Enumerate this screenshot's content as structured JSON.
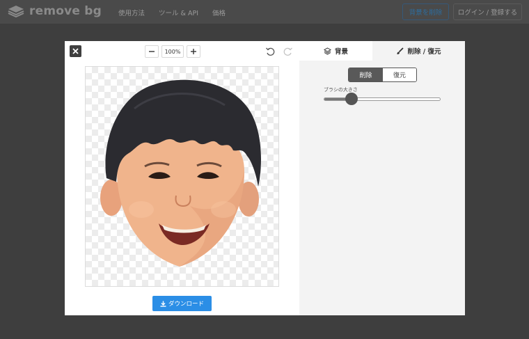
{
  "header": {
    "logo_text": "remove bg",
    "nav": [
      "使用方法",
      "ツール & API",
      "価格"
    ],
    "remove_bg_label": "背景を削除",
    "login_label": "ログイン / 登録する"
  },
  "editor": {
    "zoom_level": "100%",
    "download_label": "ダウンロード",
    "tabs": {
      "background_label": "背景",
      "erase_restore_label": "削除 / 復元"
    },
    "mode": {
      "erase_label": "削除",
      "restore_label": "復元",
      "selected": "削除"
    },
    "brush": {
      "label": "ブラシの大きさ",
      "value_fraction": 0.24
    }
  },
  "colors": {
    "accent": "#2b8ee6",
    "active_segment": "#595959"
  }
}
